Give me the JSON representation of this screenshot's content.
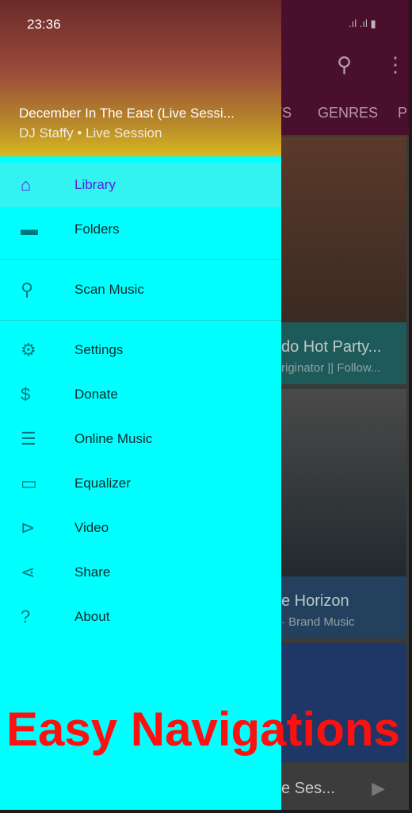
{
  "status_bar": {
    "time": "23:36",
    "signal": ".ıl .ıl ▮"
  },
  "now_playing": {
    "title": "December In The East (Live Sessi...",
    "subtitle": "DJ Staffy  •  Live Session"
  },
  "drawer": {
    "items": [
      {
        "label": "Library",
        "icon": "home-icon",
        "active": true
      },
      {
        "label": "Folders",
        "icon": "folder-icon"
      },
      {
        "label": "Scan Music",
        "icon": "search-icon"
      },
      {
        "label": "Settings",
        "icon": "gear-icon"
      },
      {
        "label": "Donate",
        "icon": "dollar-icon"
      },
      {
        "label": "Online Music",
        "icon": "online-music-icon"
      },
      {
        "label": "Equalizer",
        "icon": "equalizer-icon"
      },
      {
        "label": "Video",
        "icon": "video-icon"
      },
      {
        "label": "Share",
        "icon": "share-icon"
      },
      {
        "label": "About",
        "icon": "help-icon"
      }
    ]
  },
  "background": {
    "tabs": [
      "TS",
      "GENRES",
      "P"
    ],
    "cards": [
      {
        "title": "do Hot Party...",
        "subtitle": "riginator || Follow...",
        "color": "#1f5a5a"
      },
      {
        "title": "e Horizon",
        "subtitle": "·  Brand Music",
        "color": "#23405e"
      }
    ],
    "mini_player": "e Ses..."
  },
  "promo_text": "Easy Navigations",
  "colors": {
    "drawer": "#00ffff",
    "accent": "#5b1fe0",
    "promo": "#ff1010"
  }
}
